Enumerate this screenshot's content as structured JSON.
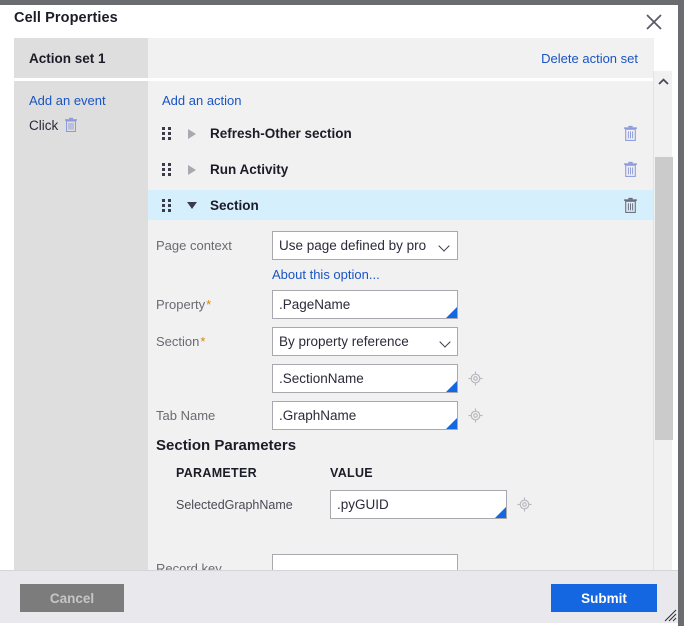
{
  "window": {
    "title": "Cell Properties",
    "close_icon": "close-icon",
    "resize_handle_icon": "resize-grip-icon"
  },
  "action_set": {
    "label": "Action set 1",
    "delete_link": "Delete action set"
  },
  "events_panel": {
    "add_event_link": "Add an event",
    "event": {
      "name": "Click",
      "delete_icon": "trash-icon"
    }
  },
  "actions_panel": {
    "add_action_link": "Add an action",
    "actions": [
      {
        "name": "Refresh-Other section",
        "expanded": false,
        "selected": false,
        "grip_icon": "drag-handle-icon",
        "toggle_icon": "triangle-right-icon",
        "delete_icon": "trash-icon"
      },
      {
        "name": "Run Activity",
        "expanded": false,
        "selected": false,
        "grip_icon": "drag-handle-icon",
        "toggle_icon": "triangle-right-icon",
        "delete_icon": "trash-icon"
      },
      {
        "name": "Section",
        "expanded": true,
        "selected": true,
        "grip_icon": "drag-handle-icon",
        "toggle_icon": "triangle-down-icon",
        "delete_icon": "trash-icon"
      }
    ]
  },
  "section_form": {
    "page_context": {
      "label": "Page context",
      "value": "Use page defined by pro",
      "options": [
        "Use page defined by pro"
      ]
    },
    "about_link": "About this option...",
    "property": {
      "label": "Property",
      "required_marker": "*",
      "value": ".PageName",
      "placeholder": ""
    },
    "section": {
      "label": "Section",
      "required_marker": "*",
      "value": "By property reference",
      "options": [
        "By property reference"
      ]
    },
    "section_name": {
      "label": "",
      "value": ".SectionName",
      "placeholder": "",
      "picker_icon": "crosshair-icon"
    },
    "tab_name": {
      "label": "Tab Name",
      "value": ".GraphName",
      "placeholder": "",
      "picker_icon": "crosshair-icon"
    },
    "section_parameters": {
      "title": "Section Parameters",
      "columns": [
        "PARAMETER",
        "VALUE"
      ],
      "rows": [
        {
          "parameter": "SelectedGraphName",
          "value": ".pyGUID",
          "picker_icon": "crosshair-icon"
        }
      ]
    },
    "record_key": {
      "label": "Record key",
      "value": "",
      "placeholder": ""
    }
  },
  "scrollbar": {
    "up_icon": "chevron-up-icon",
    "down_icon": "chevron-down-icon",
    "thumb": "scroll-thumb"
  },
  "footer": {
    "cancel_label": "Cancel",
    "submit_label": "Submit"
  },
  "colors": {
    "accent_blue": "#1467e0",
    "link_blue": "#1a54c4",
    "selected_row": "#d6effc",
    "required_orange": "#d9860b",
    "panel_gray": "#dedede",
    "content_gray": "#f1f1f1",
    "footer_gray": "#e8e8ed"
  }
}
